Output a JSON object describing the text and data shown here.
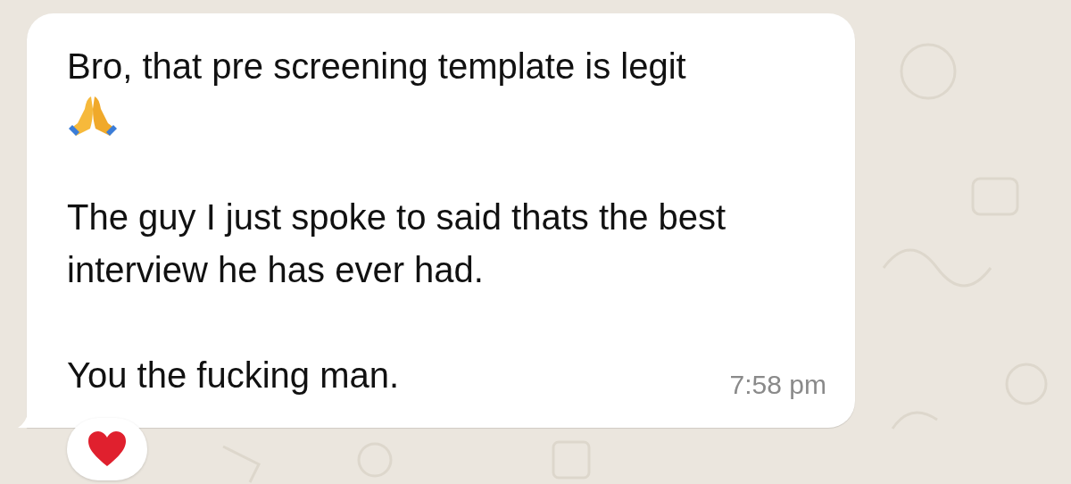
{
  "message": {
    "paragraphs": [
      "Bro, that pre screening template is legit",
      "The guy I just spoke to said thats the best interview he has ever had.",
      "You the fucking man."
    ],
    "time": "7:58 pm"
  }
}
